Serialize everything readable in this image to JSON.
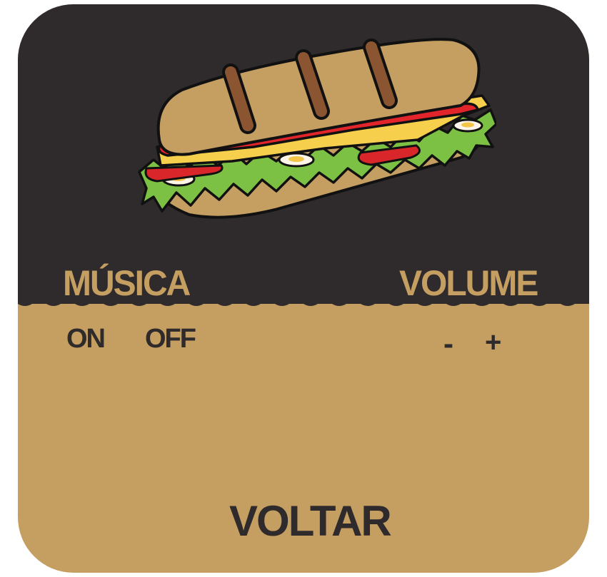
{
  "colors": {
    "dark": "#2f2b2c",
    "tan": "#c59e61"
  },
  "settings": {
    "music": {
      "label": "MÚSICA",
      "on_label": "ON",
      "off_label": "OFF"
    },
    "volume": {
      "label": "VOLUME",
      "decrease_label": "-",
      "increase_label": "+"
    },
    "back_label": "VOLTAR"
  },
  "icons": {
    "hero": "sandwich-icon"
  }
}
